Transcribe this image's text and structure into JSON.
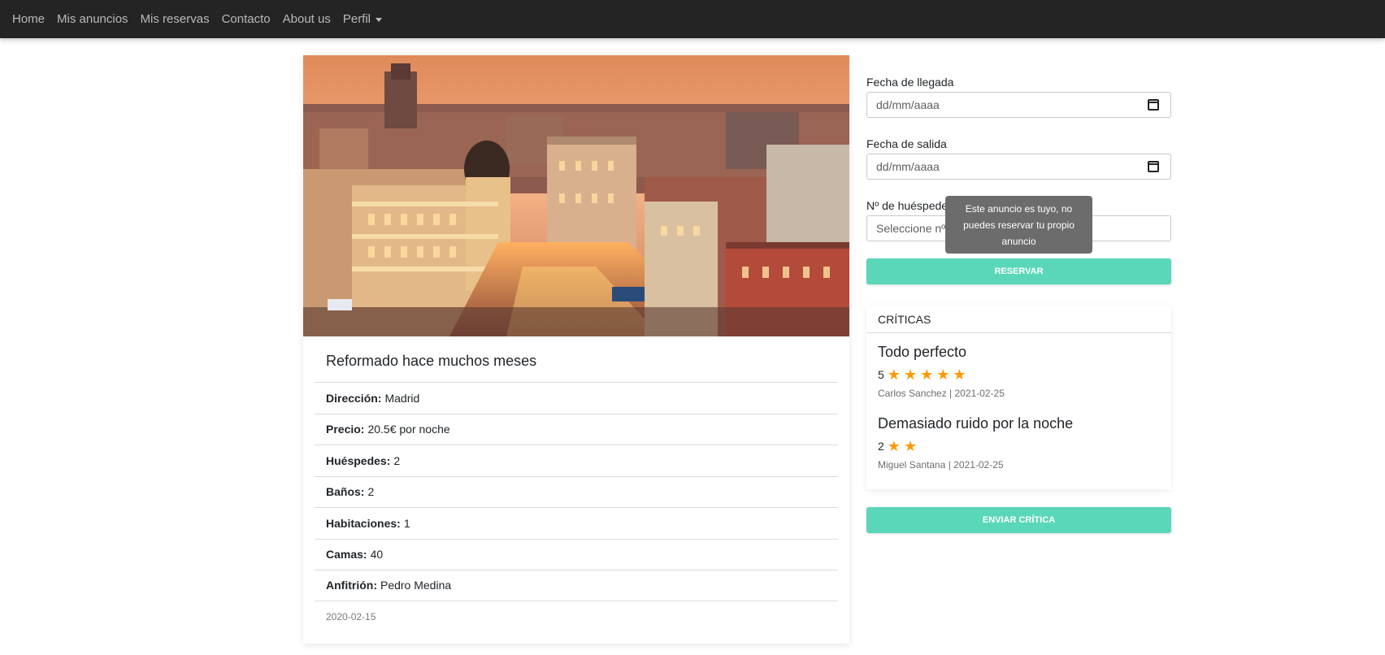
{
  "nav": {
    "items": [
      "Home",
      "Mis anuncios",
      "Mis reservas",
      "Contacto",
      "About us",
      "Perfil"
    ]
  },
  "listing": {
    "title": "Reformado hace muchos meses",
    "details": [
      {
        "label": "Dirección:",
        "value": "Madrid"
      },
      {
        "label": "Precio:",
        "value": "20.5€ por noche"
      },
      {
        "label": "Huéspedes:",
        "value": "2"
      },
      {
        "label": "Baños:",
        "value": "2"
      },
      {
        "label": "Habitaciones:",
        "value": "1"
      },
      {
        "label": "Camas:",
        "value": "40"
      },
      {
        "label": "Anfitrión:",
        "value": "Pedro Medina"
      }
    ],
    "date": "2020-02-15"
  },
  "booking": {
    "arrival_label": "Fecha de llegada",
    "arrival_placeholder": "dd/mm/aaaa",
    "departure_label": "Fecha de salida",
    "departure_placeholder": "dd/mm/aaaa",
    "guests_label": "Nº de huéspedes",
    "guests_placeholder": "Seleccione nº",
    "tooltip": "Este anuncio es tuyo, no puedes reservar tu propio anuncio",
    "reserve_label": "RESERVAR"
  },
  "reviews": {
    "header": "CRÍTICAS",
    "items": [
      {
        "title": "Todo perfecto",
        "rating": "5",
        "stars": 5,
        "meta": "Carlos Sanchez | 2021-02-25"
      },
      {
        "title": "Demasiado ruido por la noche",
        "rating": "2",
        "stars": 2,
        "meta": "Miguel Santana | 2021-02-25"
      }
    ],
    "send_label": "ENVIAR CRÍTICA"
  },
  "colors": {
    "navbar": "#242424",
    "accent": "#5ad6b8",
    "star": "#ff9800",
    "tooltip": "#6c6c6c"
  }
}
